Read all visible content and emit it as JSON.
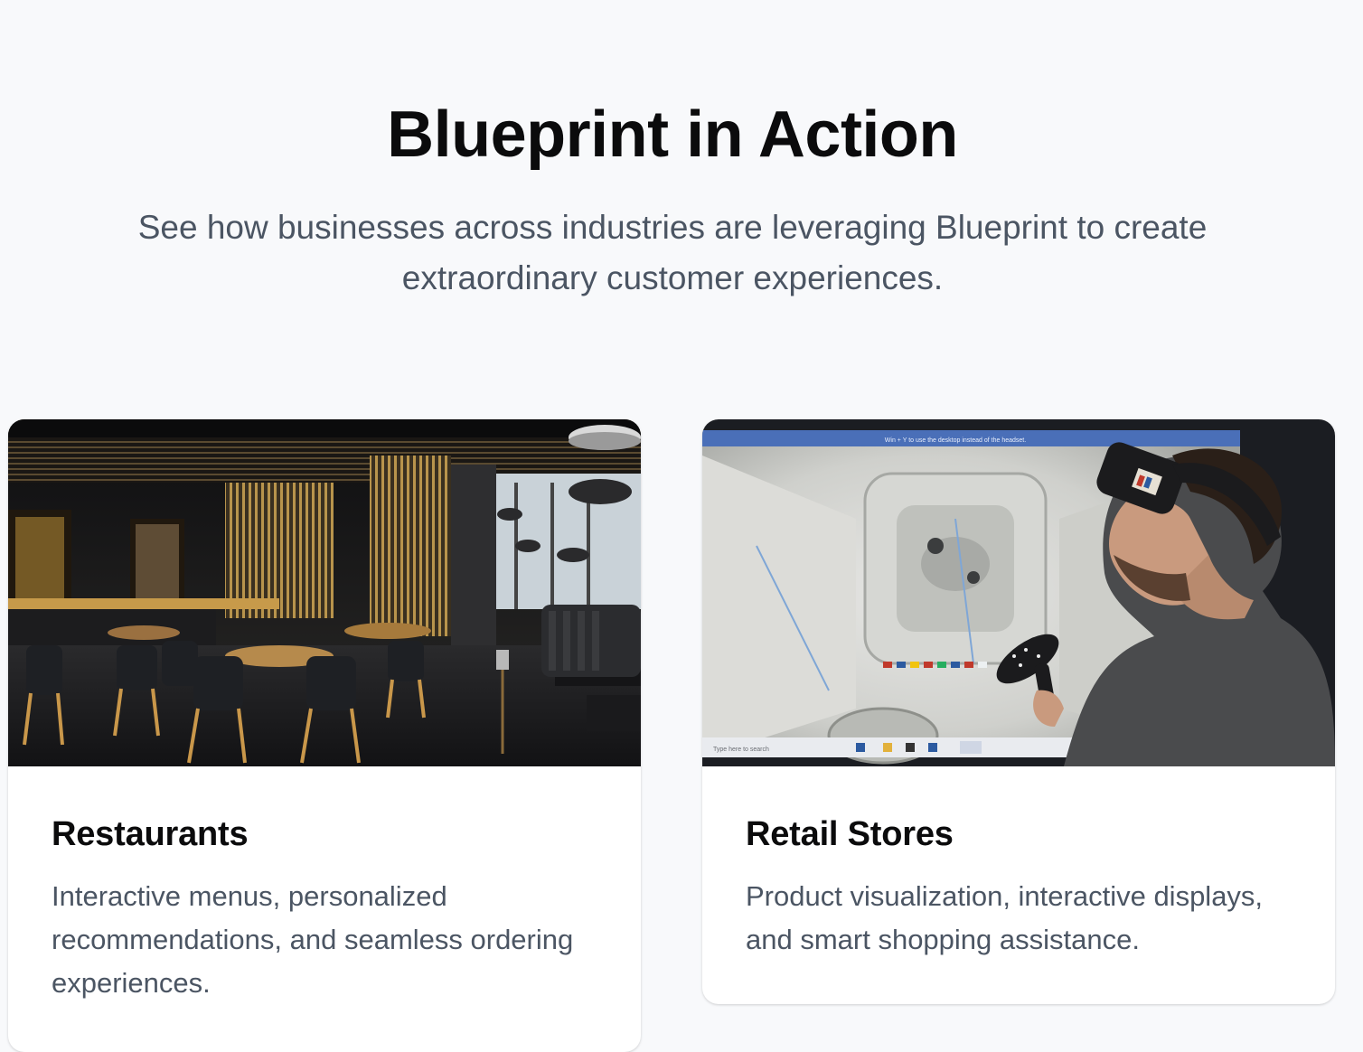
{
  "section": {
    "title": "Blueprint in Action",
    "subtitle": "See how businesses across industries are leveraging Blueprint to create extraordinary customer experiences."
  },
  "cards": [
    {
      "title": "Restaurants",
      "description": "Interactive menus, personalized recommendations, and seamless ordering experiences.",
      "image": "restaurant-interior-photo"
    },
    {
      "title": "Retail Stores",
      "description": "Product visualization, interactive displays, and smart shopping assistance.",
      "image": "vr-headset-demo-photo",
      "image_caption_text": "Win + Y to use the desktop instead of the headset.",
      "taskbar_search_placeholder": "Type here to search"
    }
  ]
}
